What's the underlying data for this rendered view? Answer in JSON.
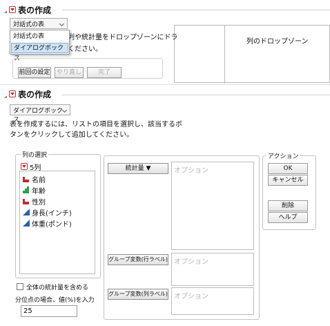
{
  "top": {
    "title": "表の作成",
    "mode_select": "対話式の表",
    "menu_items": [
      "対話式の表",
      "ダイアログボックス"
    ],
    "hint_partial_1": "列や統計量をドロップゾーンにドラ",
    "hint_partial_2": "ください。",
    "drop_zone_label": "列のドロップゾーン",
    "buttons": {
      "prev": "前回の設定",
      "redo": "やり直し",
      "done": "完了"
    }
  },
  "main": {
    "title": "表の作成",
    "mode_select": "ダイアログボックス",
    "instructions_1": "表を作成するには、リストの項目を選択し、該当するボ",
    "instructions_2": "タンをクリックして追加してください。",
    "column_select": {
      "label": "列の選択",
      "count": "5列",
      "columns": [
        {
          "name": "名前",
          "icon": "nominal-icon",
          "color": "#c0282d"
        },
        {
          "name": "年齢",
          "icon": "ordinal-icon",
          "color": "#2aa04a"
        },
        {
          "name": "性別",
          "icon": "nominal-icon",
          "color": "#c0282d"
        },
        {
          "name": "身長(インチ)",
          "icon": "continuous-icon",
          "color": "#2860b0"
        },
        {
          "name": "体重(ポンド)",
          "icon": "continuous-icon",
          "color": "#2860b0"
        }
      ]
    },
    "roles": {
      "stats": "統計量",
      "group_row": "グループ変数(行ラベル)",
      "group_col": "グループ変数(列ラベル)",
      "placeholder": "オプション"
    },
    "actions": {
      "label": "アクション",
      "ok": "OK",
      "cancel": "キャンセル",
      "remove": "削除",
      "help": "ヘルプ"
    },
    "options": {
      "include_overall": "全体の統計量を含める",
      "quantile_label": "分位点の場合、値(%)を入力",
      "quantile_value": "25"
    }
  }
}
